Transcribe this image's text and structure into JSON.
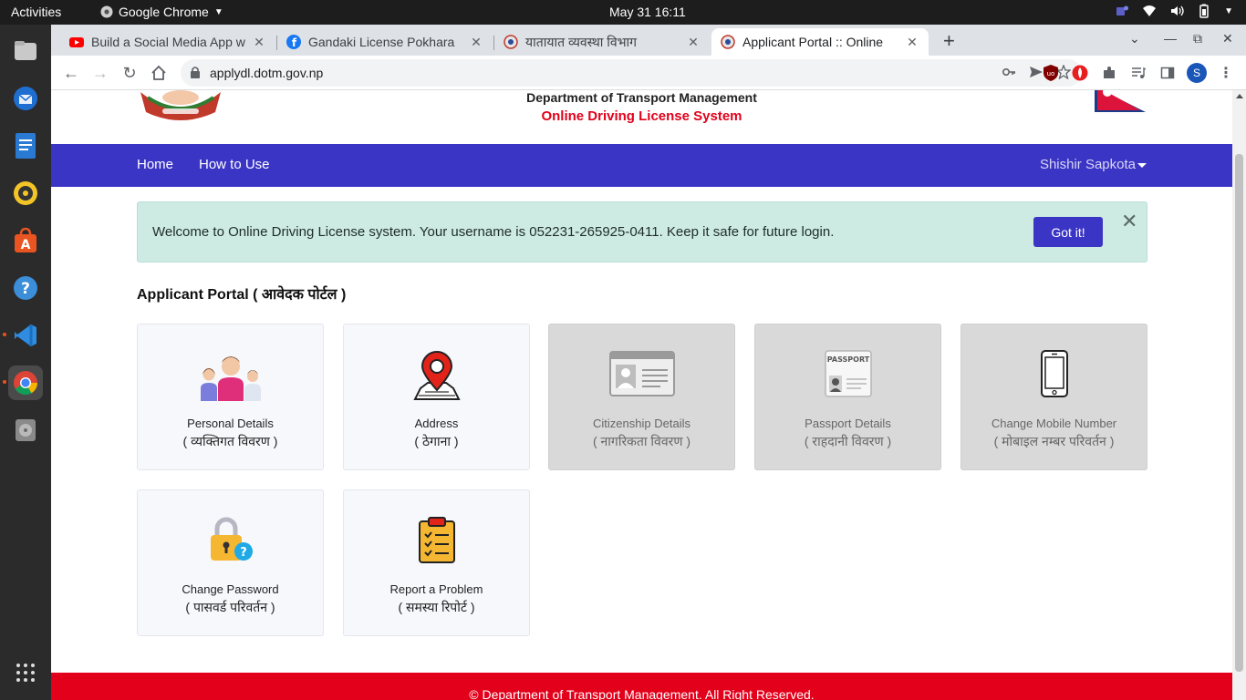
{
  "os": {
    "activities_label": "Activities",
    "app_name": "Google Chrome",
    "clock": "May 31  16:11"
  },
  "dock": {
    "items": [
      "files-icon",
      "thunderbird-icon",
      "libreoffice-writer-icon",
      "rhythmbox-icon",
      "software-center-icon",
      "help-icon",
      "vscode-icon",
      "chrome-icon",
      "disk-icon",
      "show-apps-icon"
    ]
  },
  "browser": {
    "tabs": [
      {
        "title": "Build a Social Media App w",
        "icon": "youtube-icon"
      },
      {
        "title": "Gandaki License Pokhara",
        "icon": "facebook-icon"
      },
      {
        "title": "यातायात व्यवस्था विभाग",
        "icon": "dotm-icon"
      },
      {
        "title": "Applicant Portal :: Online",
        "icon": "dotm-icon"
      }
    ],
    "url": "applydl.dotm.gov.np",
    "profile_initial": "S"
  },
  "site": {
    "dept_name": "Department of Transport Management",
    "system_name": "Online Driving License System",
    "nav": {
      "home": "Home",
      "how_to_use": "How to Use",
      "user": "Shishir Sapkota"
    },
    "alert": {
      "message": "Welcome to Online Driving License system. Your username is 052231-265925-0411. Keep it safe for future login.",
      "button": "Got it!"
    },
    "portal_title": "Applicant Portal ( आवेदक पोर्टल )",
    "cards": [
      {
        "en": "Personal Details",
        "np": "( व्यक्तिगत विवरण )",
        "icon": "family-icon",
        "enabled": true
      },
      {
        "en": "Address",
        "np": "( ठेगाना )",
        "icon": "map-pin-icon",
        "enabled": true
      },
      {
        "en": "Citizenship Details",
        "np": "( नागरिकता विवरण )",
        "icon": "id-card-icon",
        "enabled": false
      },
      {
        "en": "Passport Details",
        "np": "( राहदानी विवरण )",
        "icon": "passport-icon",
        "enabled": false
      },
      {
        "en": "Change Mobile Number",
        "np": "( मोबाइल नम्बर परिवर्तन )",
        "icon": "mobile-phone-icon",
        "enabled": false
      },
      {
        "en": "Change Password",
        "np": "( पासवर्ड परिवर्तन )",
        "icon": "padlock-icon",
        "enabled": true
      },
      {
        "en": "Report a Problem",
        "np": "( समस्या रिपोर्ट )",
        "icon": "clipboard-checklist-icon",
        "enabled": true
      }
    ],
    "footer": "© Department of Transport Management. All Right Reserved."
  },
  "colors": {
    "nav_bg": "#3b35c5",
    "brand_red": "#e2001a",
    "alert_bg": "#cdeae3"
  }
}
